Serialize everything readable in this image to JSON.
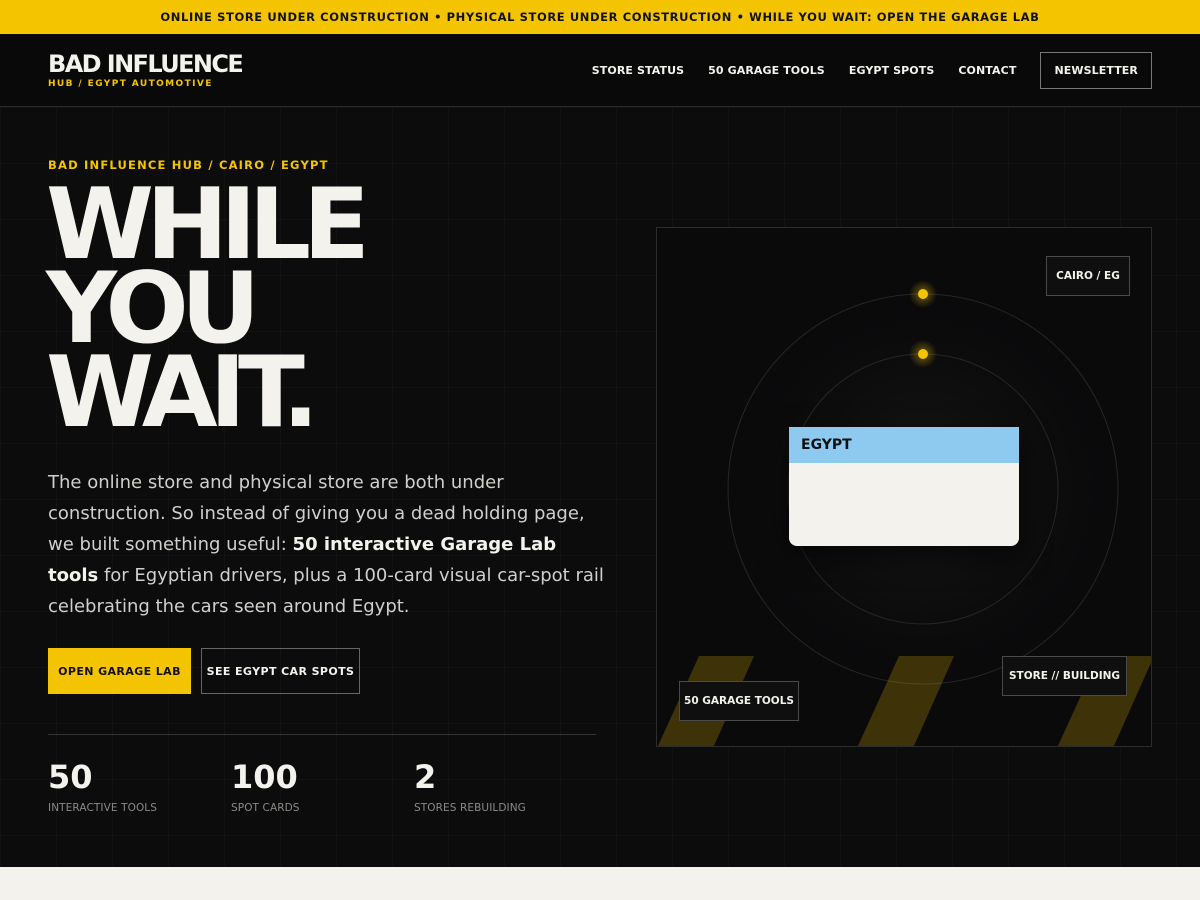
{
  "ticker": {
    "text": "ONLINE STORE UNDER CONSTRUCTION • PHYSICAL STORE UNDER CONSTRUCTION • WHILE YOU WAIT: OPEN THE GARAGE LAB"
  },
  "brand": {
    "name": "BAD INFLUENCE",
    "tagline": "HUB / EGYPT AUTOMOTIVE"
  },
  "nav": {
    "items": [
      {
        "label": "STORE STATUS"
      },
      {
        "label": "50 GARAGE TOOLS"
      },
      {
        "label": "EGYPT SPOTS"
      },
      {
        "label": "CONTACT"
      }
    ],
    "newsletter_label": "NEWSLETTER"
  },
  "hero": {
    "kicker": "BAD INFLUENCE HUB / CAIRO / EGYPT",
    "headline": {
      "line1": "WHILE",
      "line2": "YOU",
      "line3": "WAIT."
    },
    "intro": {
      "before": "The online store and physical store are both under construction. So instead of giving you a dead holding page, we built something useful: ",
      "highlight": "50 interactive Garage Lab tools",
      "after": " for Egyptian drivers, plus a 100-card visual car-spot rail celebrating the cars seen around Egypt."
    },
    "primary_cta": "OPEN GARAGE LAB",
    "secondary_cta": "SEE EGYPT CAR SPOTS",
    "stats": [
      {
        "value": "50",
        "label": "INTERACTIVE TOOLS"
      },
      {
        "value": "100",
        "label": "SPOT CARDS"
      },
      {
        "value": "2",
        "label": "STORES REBUILDING"
      }
    ]
  },
  "panel": {
    "location_tag": "CAIRO / EG",
    "card_title": "EGYPT",
    "tools_tag": "50 GARAGE TOOLS",
    "store_tag": "STORE // BUILDING"
  },
  "colors": {
    "accent": "#f5c400",
    "background": "#0c0c0d",
    "card_header": "#8ec9ef",
    "text_light": "#f3f2ed"
  }
}
